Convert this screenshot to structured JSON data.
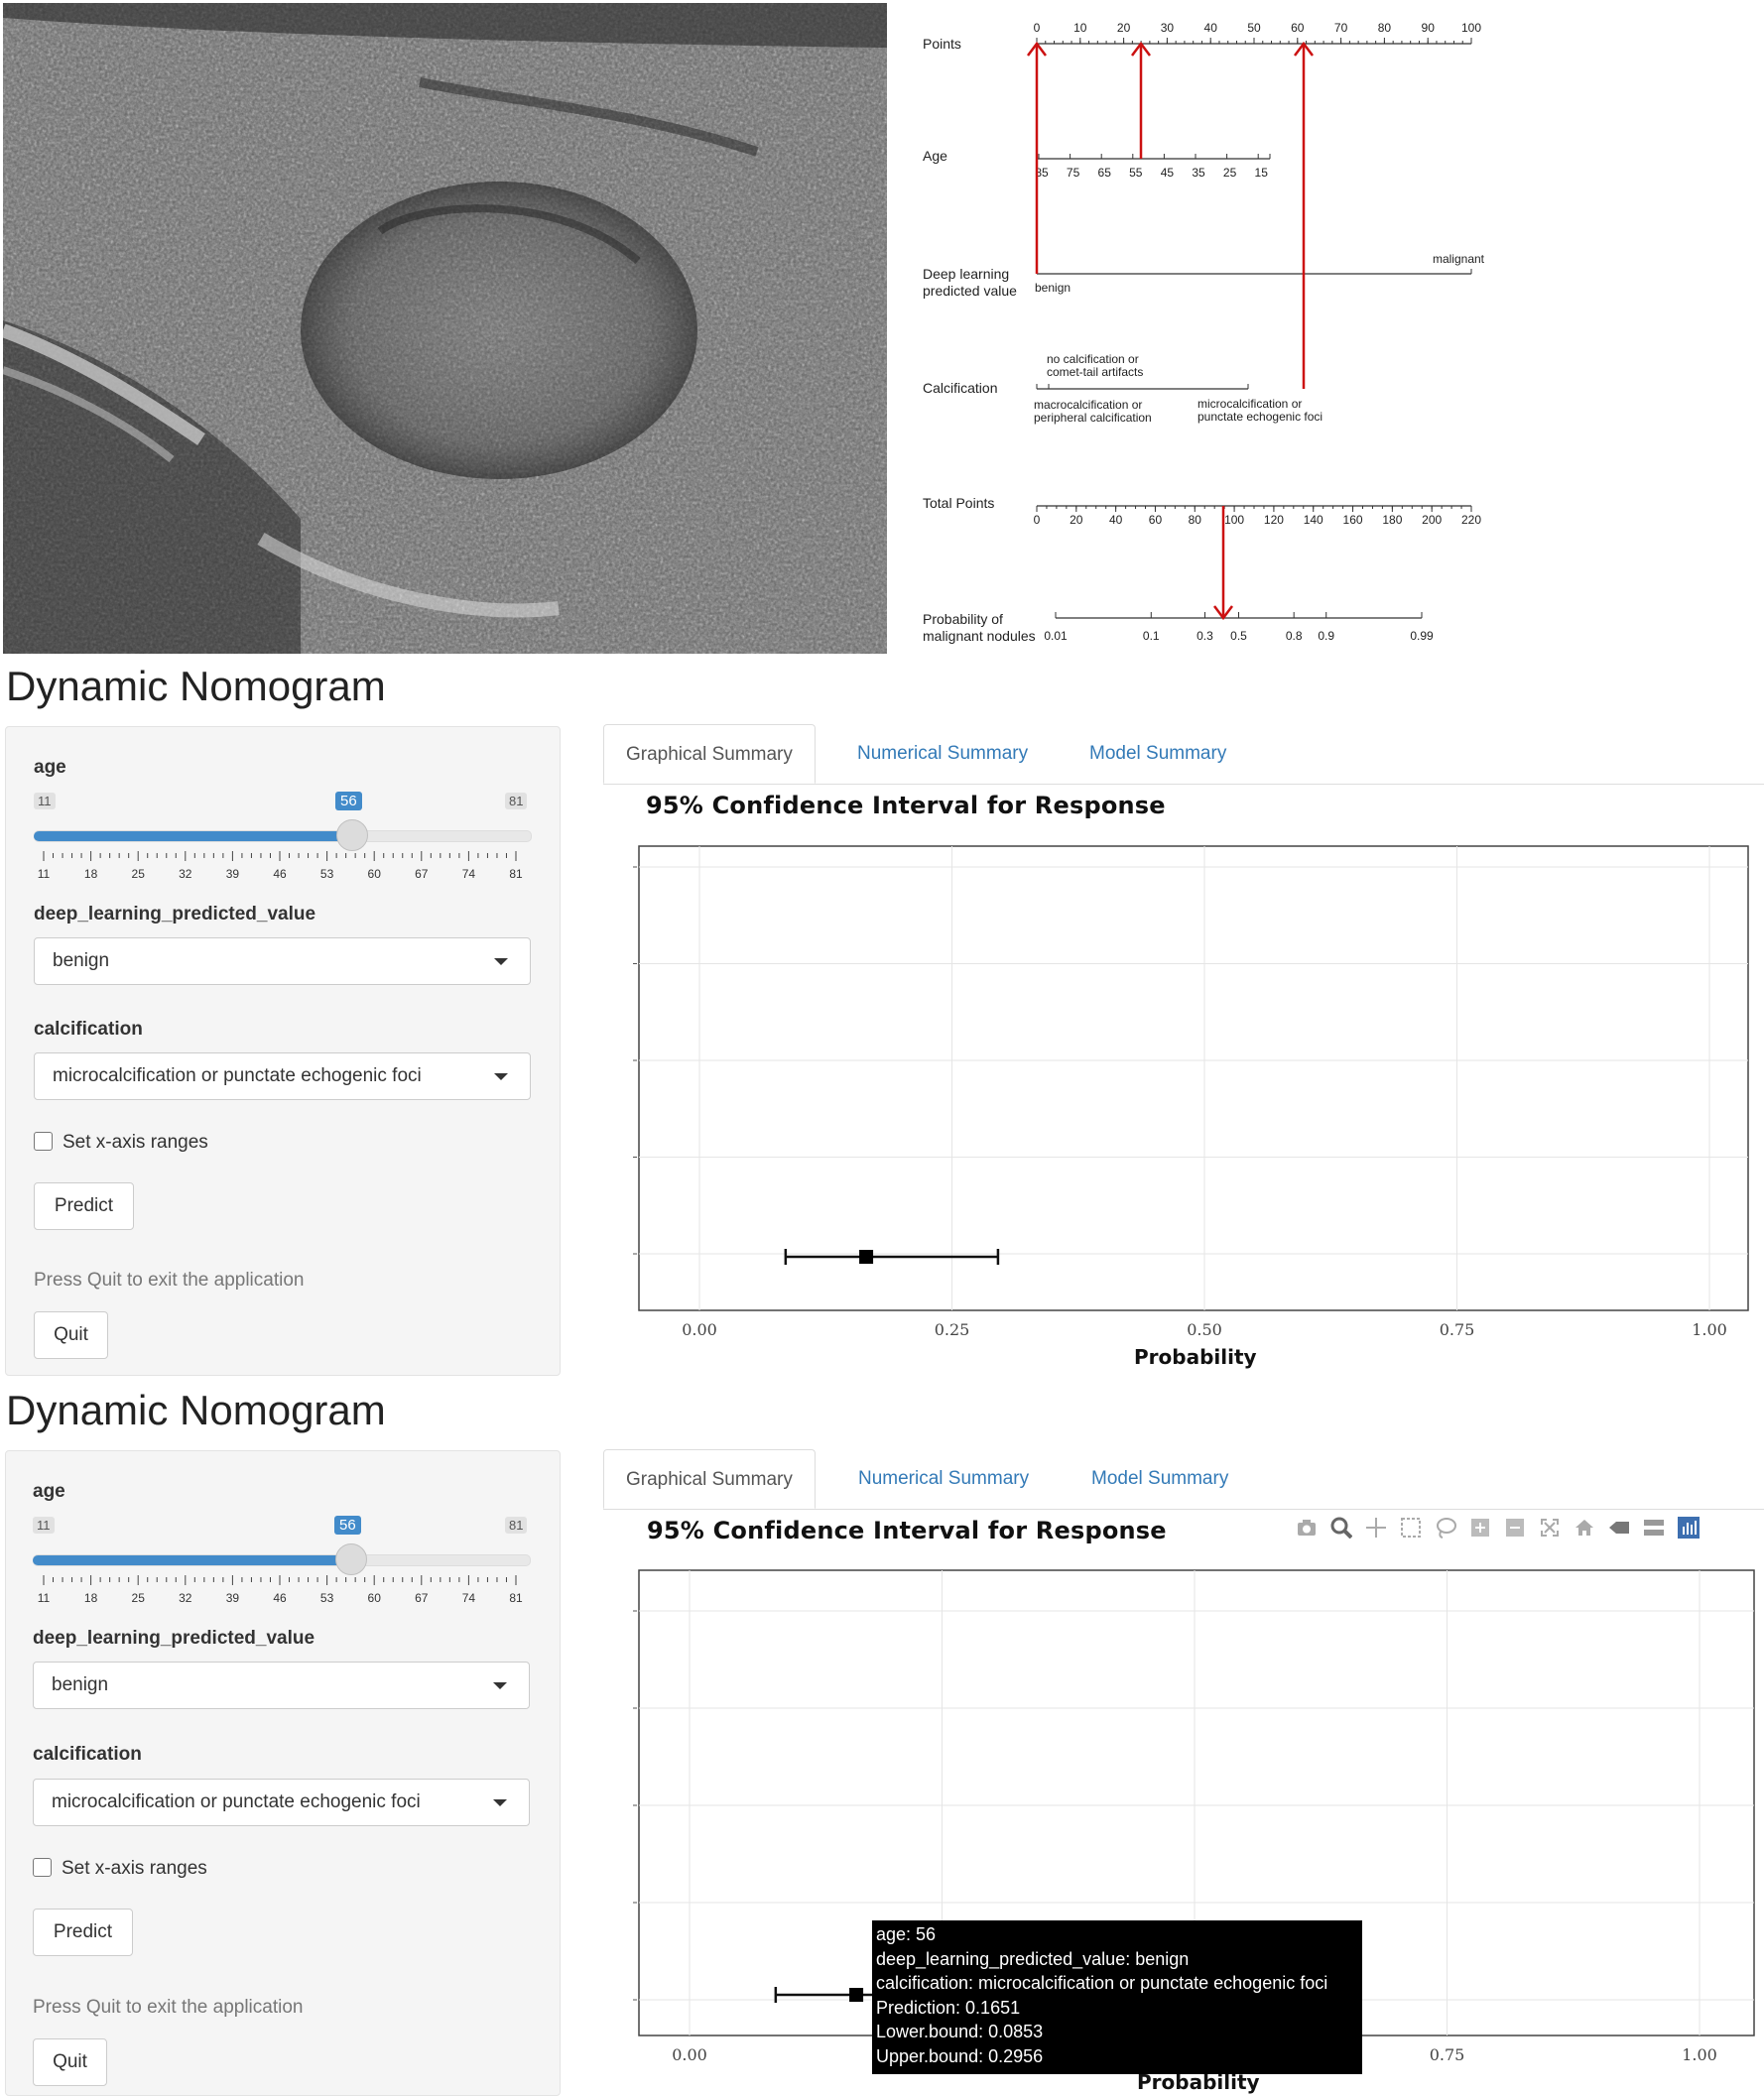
{
  "nomogram": {
    "rows": [
      {
        "label": "Points"
      },
      {
        "label": "Age"
      },
      {
        "label": "Deep learning\npredicted value"
      },
      {
        "label": "Calcification"
      },
      {
        "label": "Total Points"
      },
      {
        "label": "Probability of\nmalignant nodules"
      }
    ],
    "points_ticks": [
      "0",
      "10",
      "20",
      "30",
      "40",
      "50",
      "60",
      "70",
      "80",
      "90",
      "100"
    ],
    "age_ticks": [
      "85",
      "75",
      "65",
      "55",
      "45",
      "35",
      "25",
      "15"
    ],
    "dl_labels": {
      "benign": "benign",
      "malignant": "malignant"
    },
    "calc_labels": {
      "none": "no calcification or\ncomet-tail artifacts",
      "macro": "macrocalcification or\nperipheral calcification",
      "micro": "microcalcification or\npunctate echogenic foci"
    },
    "total_ticks": [
      "0",
      "20",
      "40",
      "60",
      "80",
      "100",
      "120",
      "140",
      "160",
      "180",
      "200",
      "220"
    ],
    "prob_ticks": [
      "0.01",
      "0.1",
      "0.3",
      "0.5",
      "0.8",
      "0.9",
      "0.99"
    ],
    "arrow_color": "#cc1111"
  },
  "panels": [
    {
      "title": "Dynamic Nomogram",
      "age_label": "age",
      "age_min": "11",
      "age_max": "81",
      "age_value": "56",
      "age_ticks": [
        "11",
        "18",
        "25",
        "32",
        "39",
        "46",
        "53",
        "60",
        "67",
        "74",
        "81"
      ],
      "dl_label": "deep_learning_predicted_value",
      "dl_value": "benign",
      "calc_label": "calcification",
      "calc_value": "microcalcification or punctate echogenic foci",
      "xrange_label": "Set x-axis ranges",
      "predict_label": "Predict",
      "quit_help": "Press Quit to exit the application",
      "quit_label": "Quit",
      "tabs": [
        "Graphical Summary",
        "Numerical Summary",
        "Model Summary"
      ],
      "plot_title": "95% Confidence Interval for Response",
      "xaxis_label": "Probability",
      "x_ticks": [
        "0.00",
        "0.25",
        "0.50",
        "0.75",
        "1.00"
      ]
    },
    {
      "title": "Dynamic Nomogram",
      "age_label": "age",
      "age_min": "11",
      "age_max": "81",
      "age_value": "56",
      "age_ticks": [
        "11",
        "18",
        "25",
        "32",
        "39",
        "46",
        "53",
        "60",
        "67",
        "74",
        "81"
      ],
      "dl_label": "deep_learning_predicted_value",
      "dl_value": "benign",
      "calc_label": "calcification",
      "calc_value": "microcalcification or punctate echogenic foci",
      "xrange_label": "Set x-axis ranges",
      "predict_label": "Predict",
      "quit_help": "Press Quit to exit the application",
      "quit_label": "Quit",
      "tabs": [
        "Graphical Summary",
        "Numerical Summary",
        "Model Summary"
      ],
      "plot_title": "95% Confidence Interval for Response",
      "xaxis_label": "Probability",
      "x_ticks": [
        "0.00",
        "",
        "",
        "0.75",
        "1.00"
      ],
      "tooltip": [
        "age: 56",
        "deep_learning_predicted_value: benign",
        "calcification: microcalcification or punctate echogenic foci",
        "Prediction: 0.1651",
        "Lower.bound: 0.0853",
        "Upper.bound: 0.2956"
      ],
      "modebar": [
        "camera-icon",
        "zoom-icon",
        "pan-icon",
        "box-select-icon",
        "lasso-icon",
        "zoom-in-icon",
        "zoom-out-icon",
        "autoscale-icon",
        "home-icon",
        "spike-icon",
        "compare-icon",
        "plotly-logo-icon"
      ]
    }
  ],
  "chart_data": {
    "type": "scatter",
    "title": "95% Confidence Interval for Response",
    "xlabel": "Probability",
    "ylabel": "",
    "xlim": [
      0,
      1
    ],
    "points": [
      {
        "x": 0.1651,
        "lower": 0.0853,
        "upper": 0.2956
      }
    ],
    "x_ticks": [
      0,
      0.25,
      0.5,
      0.75,
      1.0
    ],
    "grid": true
  },
  "colors": {
    "accent": "#428bca",
    "link": "#337ab7"
  }
}
